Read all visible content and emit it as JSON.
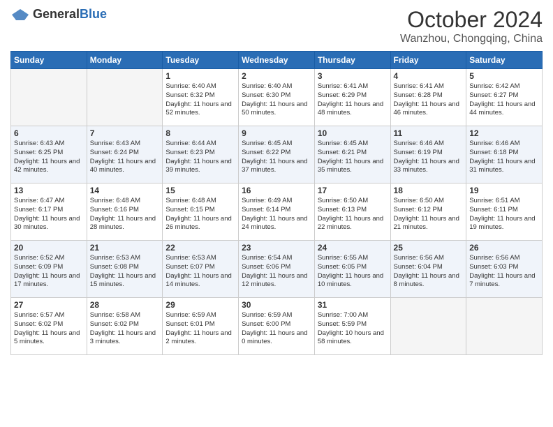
{
  "logo": {
    "general": "General",
    "blue": "Blue"
  },
  "title": "October 2024",
  "location": "Wanzhou, Chongqing, China",
  "weekdays": [
    "Sunday",
    "Monday",
    "Tuesday",
    "Wednesday",
    "Thursday",
    "Friday",
    "Saturday"
  ],
  "weeks": [
    [
      {
        "day": "",
        "sunrise": "",
        "sunset": "",
        "daylight": ""
      },
      {
        "day": "",
        "sunrise": "",
        "sunset": "",
        "daylight": ""
      },
      {
        "day": "1",
        "sunrise": "Sunrise: 6:40 AM",
        "sunset": "Sunset: 6:32 PM",
        "daylight": "Daylight: 11 hours and 52 minutes."
      },
      {
        "day": "2",
        "sunrise": "Sunrise: 6:40 AM",
        "sunset": "Sunset: 6:30 PM",
        "daylight": "Daylight: 11 hours and 50 minutes."
      },
      {
        "day": "3",
        "sunrise": "Sunrise: 6:41 AM",
        "sunset": "Sunset: 6:29 PM",
        "daylight": "Daylight: 11 hours and 48 minutes."
      },
      {
        "day": "4",
        "sunrise": "Sunrise: 6:41 AM",
        "sunset": "Sunset: 6:28 PM",
        "daylight": "Daylight: 11 hours and 46 minutes."
      },
      {
        "day": "5",
        "sunrise": "Sunrise: 6:42 AM",
        "sunset": "Sunset: 6:27 PM",
        "daylight": "Daylight: 11 hours and 44 minutes."
      }
    ],
    [
      {
        "day": "6",
        "sunrise": "Sunrise: 6:43 AM",
        "sunset": "Sunset: 6:25 PM",
        "daylight": "Daylight: 11 hours and 42 minutes."
      },
      {
        "day": "7",
        "sunrise": "Sunrise: 6:43 AM",
        "sunset": "Sunset: 6:24 PM",
        "daylight": "Daylight: 11 hours and 40 minutes."
      },
      {
        "day": "8",
        "sunrise": "Sunrise: 6:44 AM",
        "sunset": "Sunset: 6:23 PM",
        "daylight": "Daylight: 11 hours and 39 minutes."
      },
      {
        "day": "9",
        "sunrise": "Sunrise: 6:45 AM",
        "sunset": "Sunset: 6:22 PM",
        "daylight": "Daylight: 11 hours and 37 minutes."
      },
      {
        "day": "10",
        "sunrise": "Sunrise: 6:45 AM",
        "sunset": "Sunset: 6:21 PM",
        "daylight": "Daylight: 11 hours and 35 minutes."
      },
      {
        "day": "11",
        "sunrise": "Sunrise: 6:46 AM",
        "sunset": "Sunset: 6:19 PM",
        "daylight": "Daylight: 11 hours and 33 minutes."
      },
      {
        "day": "12",
        "sunrise": "Sunrise: 6:46 AM",
        "sunset": "Sunset: 6:18 PM",
        "daylight": "Daylight: 11 hours and 31 minutes."
      }
    ],
    [
      {
        "day": "13",
        "sunrise": "Sunrise: 6:47 AM",
        "sunset": "Sunset: 6:17 PM",
        "daylight": "Daylight: 11 hours and 30 minutes."
      },
      {
        "day": "14",
        "sunrise": "Sunrise: 6:48 AM",
        "sunset": "Sunset: 6:16 PM",
        "daylight": "Daylight: 11 hours and 28 minutes."
      },
      {
        "day": "15",
        "sunrise": "Sunrise: 6:48 AM",
        "sunset": "Sunset: 6:15 PM",
        "daylight": "Daylight: 11 hours and 26 minutes."
      },
      {
        "day": "16",
        "sunrise": "Sunrise: 6:49 AM",
        "sunset": "Sunset: 6:14 PM",
        "daylight": "Daylight: 11 hours and 24 minutes."
      },
      {
        "day": "17",
        "sunrise": "Sunrise: 6:50 AM",
        "sunset": "Sunset: 6:13 PM",
        "daylight": "Daylight: 11 hours and 22 minutes."
      },
      {
        "day": "18",
        "sunrise": "Sunrise: 6:50 AM",
        "sunset": "Sunset: 6:12 PM",
        "daylight": "Daylight: 11 hours and 21 minutes."
      },
      {
        "day": "19",
        "sunrise": "Sunrise: 6:51 AM",
        "sunset": "Sunset: 6:11 PM",
        "daylight": "Daylight: 11 hours and 19 minutes."
      }
    ],
    [
      {
        "day": "20",
        "sunrise": "Sunrise: 6:52 AM",
        "sunset": "Sunset: 6:09 PM",
        "daylight": "Daylight: 11 hours and 17 minutes."
      },
      {
        "day": "21",
        "sunrise": "Sunrise: 6:53 AM",
        "sunset": "Sunset: 6:08 PM",
        "daylight": "Daylight: 11 hours and 15 minutes."
      },
      {
        "day": "22",
        "sunrise": "Sunrise: 6:53 AM",
        "sunset": "Sunset: 6:07 PM",
        "daylight": "Daylight: 11 hours and 14 minutes."
      },
      {
        "day": "23",
        "sunrise": "Sunrise: 6:54 AM",
        "sunset": "Sunset: 6:06 PM",
        "daylight": "Daylight: 11 hours and 12 minutes."
      },
      {
        "day": "24",
        "sunrise": "Sunrise: 6:55 AM",
        "sunset": "Sunset: 6:05 PM",
        "daylight": "Daylight: 11 hours and 10 minutes."
      },
      {
        "day": "25",
        "sunrise": "Sunrise: 6:56 AM",
        "sunset": "Sunset: 6:04 PM",
        "daylight": "Daylight: 11 hours and 8 minutes."
      },
      {
        "day": "26",
        "sunrise": "Sunrise: 6:56 AM",
        "sunset": "Sunset: 6:03 PM",
        "daylight": "Daylight: 11 hours and 7 minutes."
      }
    ],
    [
      {
        "day": "27",
        "sunrise": "Sunrise: 6:57 AM",
        "sunset": "Sunset: 6:02 PM",
        "daylight": "Daylight: 11 hours and 5 minutes."
      },
      {
        "day": "28",
        "sunrise": "Sunrise: 6:58 AM",
        "sunset": "Sunset: 6:02 PM",
        "daylight": "Daylight: 11 hours and 3 minutes."
      },
      {
        "day": "29",
        "sunrise": "Sunrise: 6:59 AM",
        "sunset": "Sunset: 6:01 PM",
        "daylight": "Daylight: 11 hours and 2 minutes."
      },
      {
        "day": "30",
        "sunrise": "Sunrise: 6:59 AM",
        "sunset": "Sunset: 6:00 PM",
        "daylight": "Daylight: 11 hours and 0 minutes."
      },
      {
        "day": "31",
        "sunrise": "Sunrise: 7:00 AM",
        "sunset": "Sunset: 5:59 PM",
        "daylight": "Daylight: 10 hours and 58 minutes."
      },
      {
        "day": "",
        "sunrise": "",
        "sunset": "",
        "daylight": ""
      },
      {
        "day": "",
        "sunrise": "",
        "sunset": "",
        "daylight": ""
      }
    ]
  ]
}
